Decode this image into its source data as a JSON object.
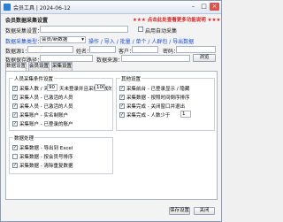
{
  "window": {
    "title": "会员工具 | 2024-06-12"
  },
  "header": {
    "group_title": "会员数据采集设置",
    "banner": "★★★ 点击此处查看更多功能说明 ★★★"
  },
  "row1": {
    "label": "数据采集设置：",
    "input_value": "",
    "checkbox_label": "启用自动采集",
    "checkbox_checked": false
  },
  "row2": {
    "label": "数据采集类型：",
    "select_value": "会员/新数据",
    "select_arrow": "▾",
    "link": "操作 / 导入 / 批量 / 单个 / 人群包 / 导出数据"
  },
  "row3": {
    "label1": "数据源1：",
    "value1": "",
    "label2": "姓名：",
    "value2": "",
    "label3": "客户：",
    "value3": "",
    "label4": "密码：",
    "value4": ""
  },
  "row4": {
    "label1": "数据保存路径：",
    "value1": "",
    "label2": "数据来源：",
    "value2": "",
    "browse": "浏览"
  },
  "tabs": [
    {
      "label": "数据设置"
    },
    {
      "label": "会员设置"
    },
    {
      "label": "采集设置"
    }
  ],
  "left_group": {
    "title": "人员采集条件设置",
    "items": [
      {
        "label": "采集人数 / 天数",
        "prefix": "",
        "value1": "90",
        "mid": "天未登录并且采集次数",
        "value2": "100",
        "suffix": "次",
        "checked": true
      },
      {
        "label": "采集人员 - 已激活的人员",
        "checked": true
      },
      {
        "label": "采集人员 - 已激活的人员",
        "checked": true
      },
      {
        "label": "采集账户 - 实名制账户",
        "checked": true
      },
      {
        "label": "采集账户 - 已登录的账户",
        "checked": true
      }
    ]
  },
  "right_group": {
    "title": "其他设置",
    "items": [
      {
        "label": "采集前台 - 已登录显示 / 隐藏",
        "checked": true
      },
      {
        "label": "采集数据 - 按照时间倒序排序",
        "checked": true
      },
      {
        "label": "采集完成 - 关闭窗口并退出",
        "checked": true
      },
      {
        "label": "采集完成 - 人数少于",
        "value": "1",
        "checked": true
      }
    ]
  },
  "bottom_group": {
    "title": "数据处理",
    "items": [
      {
        "label": "采集数据 - 导出到 Excel",
        "checked": true
      },
      {
        "label": "采集数据 - 按会员号排序",
        "checked": false
      },
      {
        "label": "采集数据 - 清除重复数据",
        "checked": true
      }
    ]
  },
  "footer": {
    "save": "保存设置",
    "close": "关闭"
  }
}
